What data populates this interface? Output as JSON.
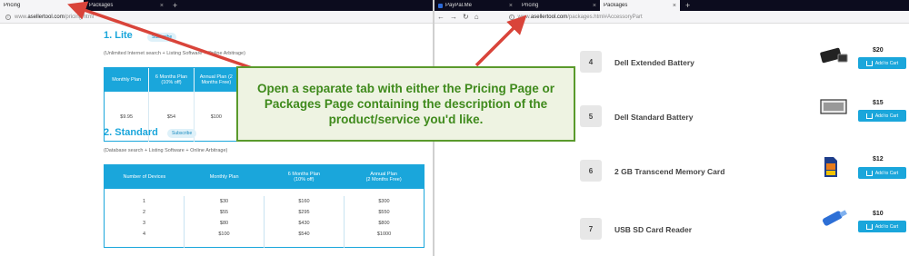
{
  "left_browser": {
    "tabs": [
      {
        "label": "Pricing",
        "active": true
      },
      {
        "label": "Packages",
        "active": false
      }
    ],
    "new_tab": "+",
    "close_glyph": "×",
    "url_prefix": "www.",
    "url_host": "asellertool.com",
    "url_path": "/pricing.html"
  },
  "pricing": {
    "lite": {
      "title": "1. Lite",
      "subscribe": "Subscribe",
      "desc": "(Unlimited Internet search + Listing Software + Online Arbitrage)",
      "headers": [
        "Monthly Plan",
        "6 Months Plan (10% off)",
        "Annual Plan (2 Months Free)"
      ],
      "values": [
        "$9.95",
        "$54",
        "$100"
      ]
    },
    "standard": {
      "title": "2. Standard",
      "subscribe": "Subscribe",
      "desc": "(Database search + Listing Software + Online Arbitrage)",
      "headers": [
        "Number of Devices",
        "Monthly Plan",
        "6 Months Plan\n(10% off)",
        "Annual Plan\n(2 Months Free)"
      ],
      "devices": [
        "1",
        "2",
        "3",
        "4"
      ],
      "monthly": [
        "$30",
        "$55",
        "$80",
        "$100"
      ],
      "six_months": [
        "$160",
        "$295",
        "$430",
        "$540"
      ],
      "annual": [
        "$300",
        "$550",
        "$800",
        "$1000"
      ]
    }
  },
  "right_browser": {
    "tabs": [
      {
        "label": "PayPal.Me",
        "active": false
      },
      {
        "label": "Pricing",
        "active": false
      },
      {
        "label": "Packages",
        "active": true
      }
    ],
    "new_tab": "+",
    "close_glyph": "×",
    "url_prefix": "www.",
    "url_host": "asellertool.com",
    "url_path": "/packages.html#AccessoryPart"
  },
  "packages": {
    "add_to_cart": "Add to Cart",
    "items": [
      {
        "num": "4",
        "name": "Dell Extended Battery",
        "price": "$20",
        "icon": "battery-icon"
      },
      {
        "num": "5",
        "name": "Dell Standard Battery",
        "price": "$15",
        "icon": "battery-icon"
      },
      {
        "num": "6",
        "name": "2 GB Transcend Memory Card",
        "price": "$12",
        "icon": "sd-card-icon"
      },
      {
        "num": "7",
        "name": "USB SD Card Reader",
        "price": "$10",
        "icon": "card-reader-icon"
      }
    ]
  },
  "callout": {
    "text": "Open a separate tab with either the Pricing Page or Packages Page containing the description of the product/service you'd like."
  },
  "colors": {
    "accent": "#1aa6db",
    "callout_border": "#5a9a2c",
    "callout_text": "#3f8a1c",
    "arrow": "#d9443a",
    "tabbar": "#0c0c1e"
  }
}
